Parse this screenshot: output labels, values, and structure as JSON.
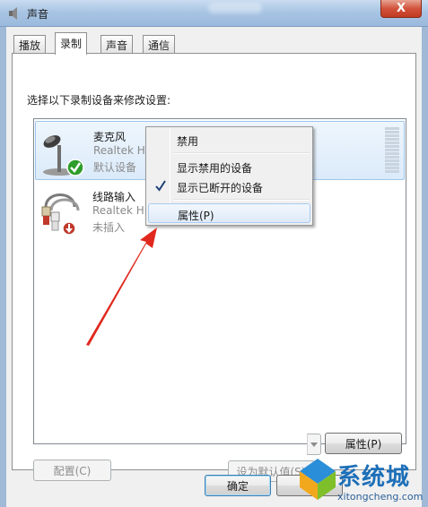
{
  "window": {
    "title": "声音",
    "close_label": "X"
  },
  "tabs": [
    {
      "label": "播放",
      "active": false
    },
    {
      "label": "录制",
      "active": true
    },
    {
      "label": "声音",
      "active": false
    },
    {
      "label": "通信",
      "active": false
    }
  ],
  "instruction": "选择以下录制设备来修改设置:",
  "devices": [
    {
      "name": "麦克风",
      "driver": "Realtek High Definition Audio",
      "status": "默认设备",
      "selected": true,
      "badge": "default-check"
    },
    {
      "name": "线路输入",
      "driver": "Realtek High Definition Audio",
      "status": "未插入",
      "selected": false,
      "badge": "unplugged"
    }
  ],
  "context_menu": {
    "items": [
      {
        "label": "禁用",
        "checked": false
      },
      {
        "label": "显示禁用的设备",
        "checked": false
      },
      {
        "label": "显示已断开的设备",
        "checked": true
      },
      {
        "label": "属性(P)",
        "checked": false,
        "highlighted": true
      }
    ]
  },
  "buttons": {
    "configure": "配置(C)",
    "set_default": "设为默认值(S)",
    "properties": "属性(P)",
    "ok": "确定",
    "cancel": "消"
  },
  "watermark": {
    "title": "系统城",
    "url": "xitongcheng.com"
  },
  "colors": {
    "accent_blue": "#1d6fb8",
    "selection_bg": "#dbeafa",
    "arrow_red": "#e0281e",
    "check_green": "#2e9d2b"
  }
}
